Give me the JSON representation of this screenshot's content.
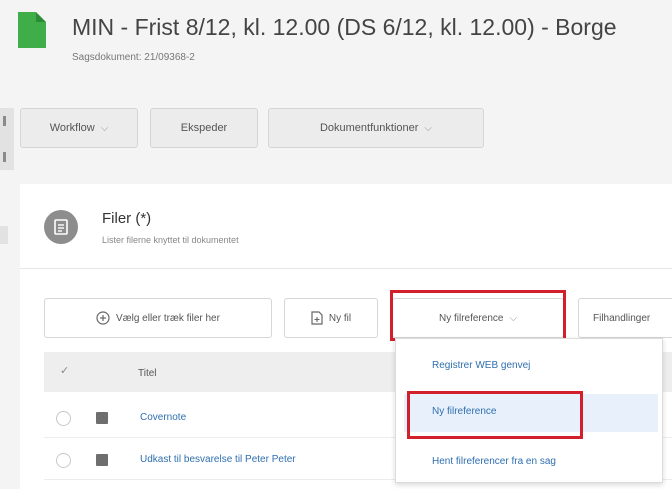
{
  "header": {
    "title": "MIN - Frist 8/12, kl. 12.00 (DS 6/12, kl. 12.00) - Borge",
    "subtitle": "Sagsdokument: 21/09368-2"
  },
  "toolbar": {
    "workflow_label": "Workflow",
    "ekspeder_label": "Ekspeder",
    "dokumentfunktioner_label": "Dokumentfunktioner"
  },
  "files_panel": {
    "title": "Filer (*)",
    "subtitle": "Lister filerne knyttet til dokumentet",
    "actions": {
      "select_files": "Vælg eller træk filer her",
      "new_file": "Ny fil",
      "new_file_reference": "Ny filreference",
      "file_actions": "Filhandlinger"
    },
    "table": {
      "header_check": "✓",
      "header_title": "Titel",
      "rows": [
        {
          "title": "Covernote"
        },
        {
          "title": "Udkast til besvarelse til Peter Peter"
        }
      ]
    }
  },
  "dropdown": {
    "items": [
      "Registrer WEB genvej",
      "Ny filreference",
      "Hent filreferencer fra en sag"
    ],
    "highlighted_index": 1
  },
  "colors": {
    "highlight_box": "#d31f2b",
    "link": "#2f6fb0",
    "doc_icon": "#3fae49"
  }
}
